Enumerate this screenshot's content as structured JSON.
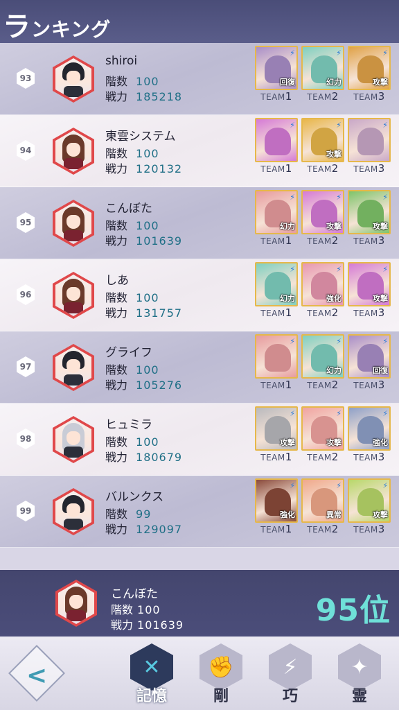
{
  "header": {
    "title_big": "ラ",
    "title_rest": "ンキング"
  },
  "rows": [
    {
      "rank": "93",
      "name": "shiroi",
      "floor_label": "階数",
      "floor": "100",
      "power_label": "戦力",
      "power": "185218",
      "teams": [
        {
          "tag": "回復",
          "color": "#a98ec8",
          "label": "TEAM",
          "n": "1"
        },
        {
          "tag": "幻力",
          "color": "#7fd0c0",
          "label": "TEAM",
          "n": "2"
        },
        {
          "tag": "攻撃",
          "color": "#e0a248",
          "label": "TEAM",
          "n": "3"
        }
      ]
    },
    {
      "rank": "94",
      "name": "東雲システム",
      "floor_label": "階数",
      "floor": "100",
      "power_label": "戦力",
      "power": "120132",
      "teams": [
        {
          "tag": "",
          "color": "#d57ad6",
          "label": "TEAM",
          "n": "1"
        },
        {
          "tag": "攻撃",
          "color": "#e8b64a",
          "label": "TEAM",
          "n": "2"
        },
        {
          "tag": "",
          "color": "#c9a8c8",
          "label": "TEAM",
          "n": "3"
        }
      ]
    },
    {
      "rank": "95",
      "name": "こんぼた",
      "floor_label": "階数",
      "floor": "100",
      "power_label": "戦力",
      "power": "101639",
      "teams": [
        {
          "tag": "幻力",
          "color": "#e79b9e",
          "label": "TEAM",
          "n": "1"
        },
        {
          "tag": "攻撃",
          "color": "#d57ad6",
          "label": "TEAM",
          "n": "2"
        },
        {
          "tag": "攻撃",
          "color": "#7fc46a",
          "label": "TEAM",
          "n": "3"
        }
      ]
    },
    {
      "rank": "96",
      "name": "しあ",
      "floor_label": "階数",
      "floor": "100",
      "power_label": "戦力",
      "power": "131757",
      "teams": [
        {
          "tag": "幻力",
          "color": "#7fd0c0",
          "label": "TEAM",
          "n": "1"
        },
        {
          "tag": "強化",
          "color": "#e896b0",
          "label": "TEAM",
          "n": "2"
        },
        {
          "tag": "攻撃",
          "color": "#d57ad6",
          "label": "TEAM",
          "n": "3"
        }
      ]
    },
    {
      "rank": "97",
      "name": "グライフ",
      "floor_label": "階数",
      "floor": "100",
      "power_label": "戦力",
      "power": "105276",
      "teams": [
        {
          "tag": "",
          "color": "#e79b9e",
          "label": "TEAM",
          "n": "1"
        },
        {
          "tag": "幻力",
          "color": "#7fd0c0",
          "label": "TEAM",
          "n": "2"
        },
        {
          "tag": "回復",
          "color": "#a98ec8",
          "label": "TEAM",
          "n": "3"
        }
      ]
    },
    {
      "rank": "98",
      "name": "ヒュミラ",
      "floor_label": "階数",
      "floor": "100",
      "power_label": "戦力",
      "power": "180679",
      "teams": [
        {
          "tag": "攻撃",
          "color": "#b9b9bd",
          "label": "TEAM",
          "n": "1"
        },
        {
          "tag": "攻撃",
          "color": "#f0a3a0",
          "label": "TEAM",
          "n": "2"
        },
        {
          "tag": "強化",
          "color": "#8ea0c8",
          "label": "TEAM",
          "n": "3"
        }
      ]
    },
    {
      "rank": "99",
      "name": "バルンクス",
      "floor_label": "階数",
      "floor": "99",
      "power_label": "戦力",
      "power": "129097",
      "teams": [
        {
          "tag": "強化",
          "color": "#8a4a3a",
          "label": "TEAM",
          "n": "1"
        },
        {
          "tag": "異常",
          "color": "#f0a88a",
          "label": "TEAM",
          "n": "2"
        },
        {
          "tag": "攻撃",
          "color": "#b8d86a",
          "label": "TEAM",
          "n": "3"
        }
      ]
    }
  ],
  "me": {
    "name": "こんぼた",
    "floor_label": "階数",
    "floor": "100",
    "power_label": "戦力",
    "power": "101639",
    "rank_text": "95位"
  },
  "footer": {
    "back_icon": "chevron-left-icon",
    "tabs": [
      {
        "label": "記憶",
        "glyph": "✕",
        "active": true
      },
      {
        "label": "剛",
        "glyph": "✊",
        "active": false
      },
      {
        "label": "巧",
        "glyph": "⚡",
        "active": false
      },
      {
        "label": "霊",
        "glyph": "✦",
        "active": false
      }
    ]
  }
}
